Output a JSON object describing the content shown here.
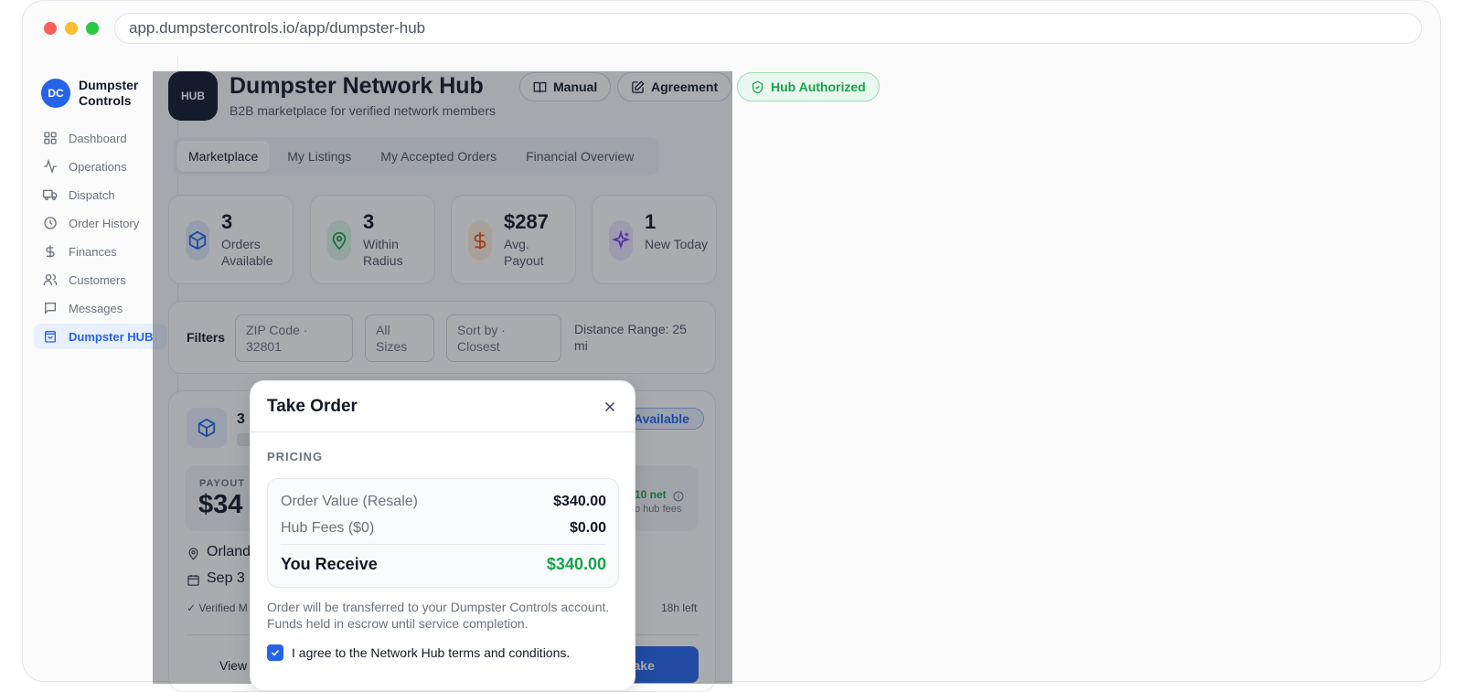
{
  "browser": {
    "url": "app.dumpstercontrols.io/app/dumpster-hub"
  },
  "sidebar": {
    "brand_initials": "DC",
    "brand_name": "Dumpster Controls",
    "items": [
      {
        "label": "Dashboard",
        "icon": "grid-icon"
      },
      {
        "label": "Operations",
        "icon": "activity-icon"
      },
      {
        "label": "Dispatch",
        "icon": "truck-icon"
      },
      {
        "label": "Order History",
        "icon": "clock-icon"
      },
      {
        "label": "Finances",
        "icon": "dollar-icon"
      },
      {
        "label": "Customers",
        "icon": "users-icon"
      },
      {
        "label": "Messages",
        "icon": "message-icon"
      },
      {
        "label": "Dumpster HUB",
        "icon": "bag-icon",
        "active": true
      }
    ]
  },
  "header": {
    "logo_text": "HUB",
    "title": "Dumpster Network Hub",
    "subtitle": "B2B marketplace for verified network members",
    "manual_label": "Manual",
    "agreement_label": "Agreement",
    "authorized_label": "Hub Authorized"
  },
  "tabs": [
    "Marketplace",
    "My Listings",
    "My Accepted Orders",
    "Financial Overview"
  ],
  "stats": [
    {
      "value": "3",
      "label": "Orders Available",
      "icon": "box-icon",
      "color": "#2563eb"
    },
    {
      "value": "3",
      "label": "Within Radius",
      "icon": "map-pin-icon",
      "color": "#16a34a"
    },
    {
      "value": "$287",
      "label": "Avg. Payout",
      "icon": "dollar-icon",
      "color": "#ea580c"
    },
    {
      "value": "1",
      "label": "New Today",
      "icon": "sparkles-icon",
      "color": "#7c3aed"
    }
  ],
  "filters": {
    "label": "Filters",
    "zip": "ZIP Code · 32801",
    "sizes": "All Sizes",
    "sort": "Sort by · Closest",
    "range": "Distance Range: 25 mi"
  },
  "order_card": {
    "title": "3",
    "badge": "Available",
    "payout_label": "PAYOUT",
    "payout_value": "$34",
    "net": "10 net",
    "fee_note": "o hub fees",
    "location": "Orland",
    "date": "Sep 3",
    "verified": "✓ Verified M",
    "time_left": "18h left",
    "view_label": "View",
    "take_label": "Take"
  },
  "modal": {
    "title": "Take Order",
    "section": "PRICING",
    "order_value_label": "Order Value (Resale)",
    "order_value": "$340.00",
    "hub_fees_label": "Hub Fees ($0)",
    "hub_fees": "$0.00",
    "receive_label": "You Receive",
    "receive_value": "$340.00",
    "note": "Order will be transferred to your Dumpster Controls account. Funds held in escrow until service completion.",
    "agree_label": "I agree to the Network Hub terms and conditions.",
    "agree_checked": true
  }
}
